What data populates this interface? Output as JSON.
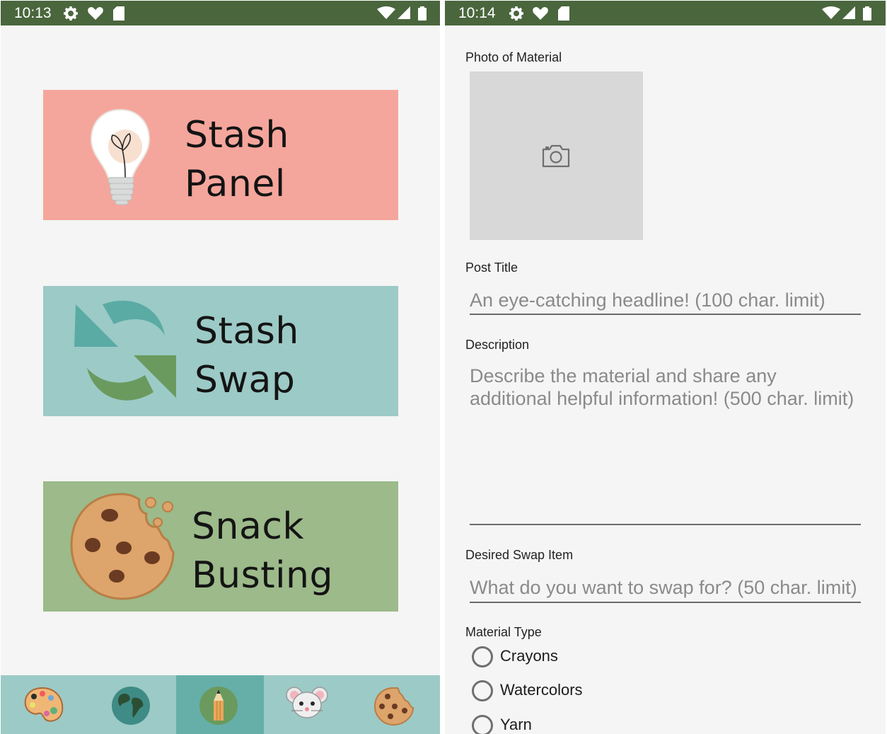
{
  "left_screen": {
    "status_bar": {
      "time": "10:13"
    },
    "cards": [
      {
        "line1": "Stash",
        "line2": "Panel",
        "color": "#f5a69c",
        "icon": "lightbulb-icon"
      },
      {
        "line1": "Stash",
        "line2": "Swap",
        "color": "#9ccac6",
        "icon": "swap-arrows-icon"
      },
      {
        "line1": "Snack",
        "line2": "Busting",
        "color": "#9cba8a",
        "icon": "cookie-icon"
      }
    ],
    "bottom_nav": {
      "items": [
        "palette-icon",
        "globe-icon",
        "pencil-icon",
        "mouse-icon",
        "cookie-icon"
      ],
      "active_index": 2,
      "bar_color": "#9ccac6",
      "active_color": "#66afa8"
    }
  },
  "right_screen": {
    "status_bar": {
      "time": "10:14"
    },
    "form": {
      "photo_label": "Photo of Material",
      "photo_placeholder_icon": "camera-icon",
      "post_title_label": "Post Title",
      "post_title_placeholder": "An eye-catching headline! (100 char. limit)",
      "description_label": "Description",
      "description_placeholder": "Describe the material and share any additional helpful information! (500 char. limit)",
      "desired_swap_label": "Desired Swap Item",
      "desired_swap_placeholder": "What do you want to swap for? (50 char. limit)",
      "material_type_label": "Material Type",
      "material_types": [
        "Crayons",
        "Watercolors",
        "Yarn"
      ]
    }
  },
  "colors": {
    "status_bar": "#4a663d",
    "background": "#f4f5f4"
  }
}
